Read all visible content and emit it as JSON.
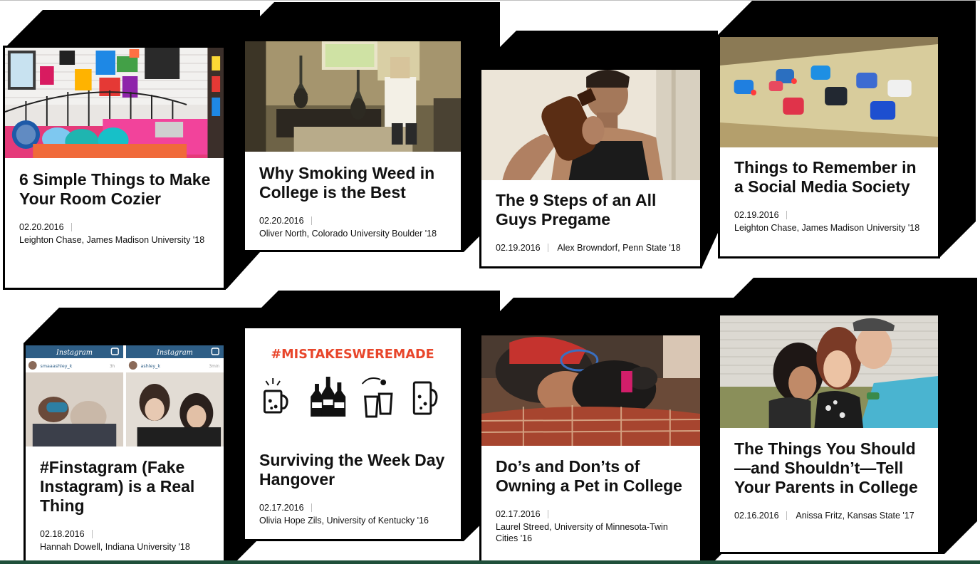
{
  "articles": [
    {
      "title": "6 Simple Things to Make Your Room Cozier",
      "date": "02.20.2016",
      "author": "Leighton Chase, James Madison University '18",
      "image": "dorm-room-photo"
    },
    {
      "title": "Why Smoking Weed in College is the Best",
      "date": "02.20.2016",
      "author": "Oliver North, Colorado University Boulder '18",
      "image": "hookah-photo"
    },
    {
      "title": "The 9 Steps of an All Guys Pregame",
      "date": "02.19.2016",
      "author": "Alex Browndorf, Penn State '18",
      "image": "drinking-photo"
    },
    {
      "title": "Things to Remember in a Social Media Society",
      "date": "02.19.2016",
      "author": "Leighton Chase, James Madison University '18",
      "image": "social-apps-photo"
    },
    {
      "title": "#Finstagram (Fake Instagram) is a Real Thing",
      "date": "02.18.2016",
      "author": "Hannah Dowell, Indiana University '18",
      "image": "instagram-screens",
      "image_text": {
        "app_name": "Instagram",
        "user_left": "smaaashley_k",
        "user_right": "ashley_k",
        "time_left": "3h",
        "time_right": "3min"
      }
    },
    {
      "title": "Surviving the Week Day Hangover",
      "date": "02.17.2016",
      "author": "Olivia Hope Zils, University of Kentucky '16",
      "image": "mistakes-graphic",
      "image_text": {
        "hashtag": "#MISTAKESWEREMADE"
      }
    },
    {
      "title": "Do’s and Don’ts of Owning a Pet in College",
      "date": "02.17.2016",
      "author": "Laurel Streed, University of Minnesota-Twin Cities '16",
      "image": "pet-photo"
    },
    {
      "title": "The Things You Should—and Shouldn’t—Tell Your Parents in College",
      "date": "02.16.2016",
      "author": "Anissa Fritz, Kansas State '17",
      "image": "family-photo"
    }
  ],
  "colors": {
    "accent": "#e8462b",
    "instagram_bar": "#2e5e86",
    "footer_bar": "#1f4f3a"
  }
}
